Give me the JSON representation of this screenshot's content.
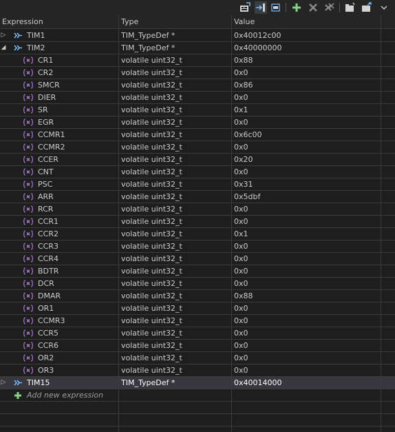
{
  "colors": {
    "background": "#1e1e1e",
    "grid_line": "#3c3c3c",
    "selection": "#37373d",
    "struct_icon": "#75beff",
    "field_icon": "#b180d7",
    "add_icon": "#89d185"
  },
  "toolbar": {
    "buttons": [
      {
        "icon": "show-as-hex-icon"
      },
      {
        "icon": "refresh-icon"
      },
      {
        "icon": "collapse-all-icon"
      },
      {
        "icon": "add-expression-icon"
      },
      {
        "icon": "remove-expression-icon"
      },
      {
        "icon": "remove-all-icon"
      },
      {
        "icon": "import-icon"
      },
      {
        "icon": "export-icon"
      },
      {
        "icon": "view-menu-chevron-icon"
      }
    ]
  },
  "columns": {
    "expression": "Expression",
    "type": "Type",
    "value": "Value"
  },
  "rows": [
    {
      "kind": "struct",
      "expanded": false,
      "name": "TIM1",
      "type": "TIM_TypeDef *",
      "value": "0x40012c00"
    },
    {
      "kind": "struct",
      "expanded": true,
      "name": "TIM2",
      "type": "TIM_TypeDef *",
      "value": "0x40000000"
    },
    {
      "kind": "field",
      "name": "CR1",
      "type": "volatile uint32_t",
      "value": "0x88"
    },
    {
      "kind": "field",
      "name": "CR2",
      "type": "volatile uint32_t",
      "value": "0x0"
    },
    {
      "kind": "field",
      "name": "SMCR",
      "type": "volatile uint32_t",
      "value": "0x86"
    },
    {
      "kind": "field",
      "name": "DIER",
      "type": "volatile uint32_t",
      "value": "0x0"
    },
    {
      "kind": "field",
      "name": "SR",
      "type": "volatile uint32_t",
      "value": "0x1"
    },
    {
      "kind": "field",
      "name": "EGR",
      "type": "volatile uint32_t",
      "value": "0x0"
    },
    {
      "kind": "field",
      "name": "CCMR1",
      "type": "volatile uint32_t",
      "value": "0x6c00"
    },
    {
      "kind": "field",
      "name": "CCMR2",
      "type": "volatile uint32_t",
      "value": "0x0"
    },
    {
      "kind": "field",
      "name": "CCER",
      "type": "volatile uint32_t",
      "value": "0x20"
    },
    {
      "kind": "field",
      "name": "CNT",
      "type": "volatile uint32_t",
      "value": "0x0"
    },
    {
      "kind": "field",
      "name": "PSC",
      "type": "volatile uint32_t",
      "value": "0x31"
    },
    {
      "kind": "field",
      "name": "ARR",
      "type": "volatile uint32_t",
      "value": "0x5dbf"
    },
    {
      "kind": "field",
      "name": "RCR",
      "type": "volatile uint32_t",
      "value": "0x0"
    },
    {
      "kind": "field",
      "name": "CCR1",
      "type": "volatile uint32_t",
      "value": "0x0"
    },
    {
      "kind": "field",
      "name": "CCR2",
      "type": "volatile uint32_t",
      "value": "0x1"
    },
    {
      "kind": "field",
      "name": "CCR3",
      "type": "volatile uint32_t",
      "value": "0x0"
    },
    {
      "kind": "field",
      "name": "CCR4",
      "type": "volatile uint32_t",
      "value": "0x0"
    },
    {
      "kind": "field",
      "name": "BDTR",
      "type": "volatile uint32_t",
      "value": "0x0"
    },
    {
      "kind": "field",
      "name": "DCR",
      "type": "volatile uint32_t",
      "value": "0x0"
    },
    {
      "kind": "field",
      "name": "DMAR",
      "type": "volatile uint32_t",
      "value": "0x88"
    },
    {
      "kind": "field",
      "name": "OR1",
      "type": "volatile uint32_t",
      "value": "0x0"
    },
    {
      "kind": "field",
      "name": "CCMR3",
      "type": "volatile uint32_t",
      "value": "0x0"
    },
    {
      "kind": "field",
      "name": "CCR5",
      "type": "volatile uint32_t",
      "value": "0x0"
    },
    {
      "kind": "field",
      "name": "CCR6",
      "type": "volatile uint32_t",
      "value": "0x0"
    },
    {
      "kind": "field",
      "name": "OR2",
      "type": "volatile uint32_t",
      "value": "0x0"
    },
    {
      "kind": "field",
      "name": "OR3",
      "type": "volatile uint32_t",
      "value": "0x0"
    },
    {
      "kind": "struct",
      "expanded": false,
      "selected": true,
      "name": "TIM15",
      "type": "TIM_TypeDef *",
      "value": "0x40014000"
    }
  ],
  "add_row": {
    "label": "Add new expression"
  }
}
